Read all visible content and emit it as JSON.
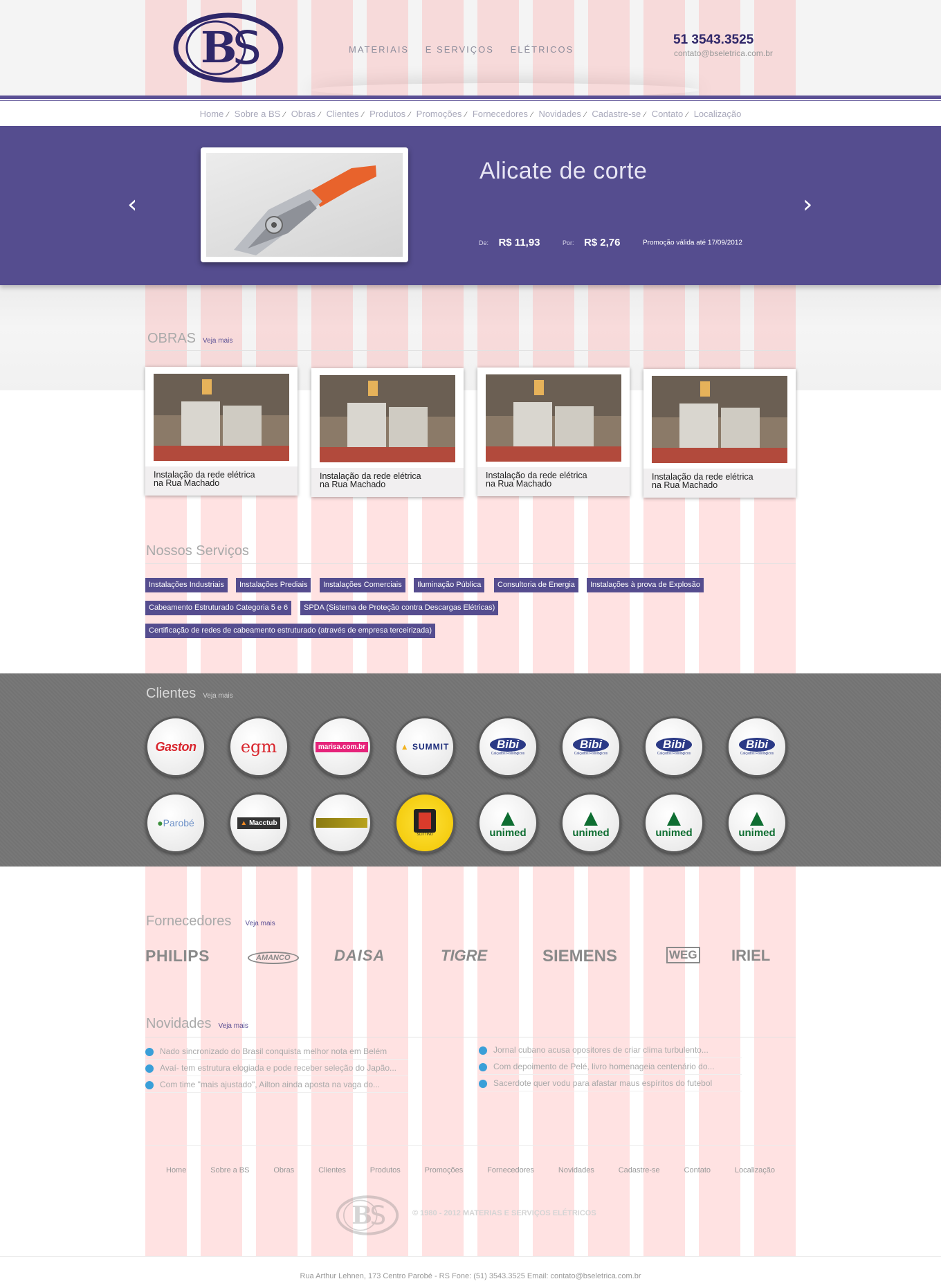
{
  "header": {
    "logo_text": "BS",
    "tagline": [
      "MATERIAIS",
      "E SERVIÇOS",
      "ELÉTRICOS"
    ],
    "phone": "51 3543.3525",
    "email": "contato@bseletrica.com.br"
  },
  "nav": {
    "items": [
      "Home",
      "Sobre a BS",
      "Obras",
      "Clientes",
      "Produtos",
      "Promoções",
      "Fornecedores",
      "Novidades",
      "Cadastre-se",
      "Contato",
      "Localização"
    ],
    "separator": "⁄"
  },
  "hero": {
    "title": "Alicate de corte",
    "from_label": "De:",
    "from_price": "R$ 11,93",
    "to_label": "Por:",
    "to_price": "R$ 2,76",
    "promo_text": "Promoção válida até 17/09/2012",
    "prev_icon": "chevron-left-icon",
    "next_icon": "chevron-right-icon"
  },
  "obras": {
    "title": "OBRAS",
    "more": "Veja mais",
    "cards": [
      {
        "line1": "Instalação da rede elétrica",
        "line2": "na Rua Machado"
      },
      {
        "line1": "Instalação da rede elétrica",
        "line2": "na Rua Machado"
      },
      {
        "line1": "Instalação da rede elétrica",
        "line2": "na Rua Machado"
      },
      {
        "line1": "Instalação da rede elétrica",
        "line2": "na Rua Machado"
      }
    ]
  },
  "servicos": {
    "title": "Nossos Serviços",
    "tags": [
      "Instalações Industriais",
      "Instalações Prediais",
      "Instalações Comerciais",
      "Iluminação Pública",
      "Consultoria de Energia",
      "Instalações à prova de Explosão",
      "Cabeamento Estruturado Categoria 5 e 6",
      "SPDA (Sistema de Proteção contra Descargas Elétricas)",
      "Certificação de redes de cabeamento estruturado (através de empresa terceirizada)"
    ]
  },
  "clientes": {
    "title": "Clientes",
    "more": "Veja mais",
    "row1": [
      "Gaston",
      "egm",
      "marisa.com.br",
      "SUMMIT",
      "Bibi",
      "Bibi",
      "Bibi",
      "Bibi"
    ],
    "row2": [
      "Parobé",
      "Macctub",
      "",
      "",
      "unimed",
      "unimed",
      "unimed",
      "unimed"
    ],
    "subtitles": {
      "bibi": "Calçados Fisiológicos",
      "summit_mark": "▲",
      "scitrino": "SCITTINO"
    }
  },
  "fornecedores": {
    "title": "Fornecedores",
    "more": "Veja mais",
    "brands": [
      "PHILIPS",
      "AMANCO",
      "DAISA",
      "TIGRE",
      "SIEMENS",
      "WEG",
      "IRIEL"
    ]
  },
  "novidades": {
    "title": "Novidades",
    "more": "Veja mais",
    "left": [
      "Nado sincronizado do Brasil conquista melhor nota em Belém",
      "Avaí- tem estrutura elogiada e pode receber seleção do Japão...",
      "Com time \"mais ajustado\", Ailton ainda aposta na vaga do..."
    ],
    "right": [
      "Jornal cubano acusa opositores de criar clima turbulento...",
      "Com depoimento de Pelé, livro homenageia centenário do...",
      "Sacerdote quer vodu para afastar maus espíritos do futebol"
    ]
  },
  "footer": {
    "links": [
      "Home",
      "Sobre a BS",
      "Obras",
      "Clientes",
      "Produtos",
      "Promoções",
      "Fornecedores",
      "Novidades",
      "Cadastre-se",
      "Contato",
      "Localização"
    ],
    "copyright": "© 1980 - 2012 MATERIAS E SERVIÇOS ELÉTRICOS",
    "address": "Rua Arthur Lehnen, 173 Centro Parobé - RS Fone: (51) 3543.3525 Email: contato@bseletrica.com.br"
  },
  "colors": {
    "brand_purple": "#554d8f",
    "brand_dark": "#2f2769",
    "clients_band": "#737373",
    "news_bullet": "#3a9fd8"
  }
}
